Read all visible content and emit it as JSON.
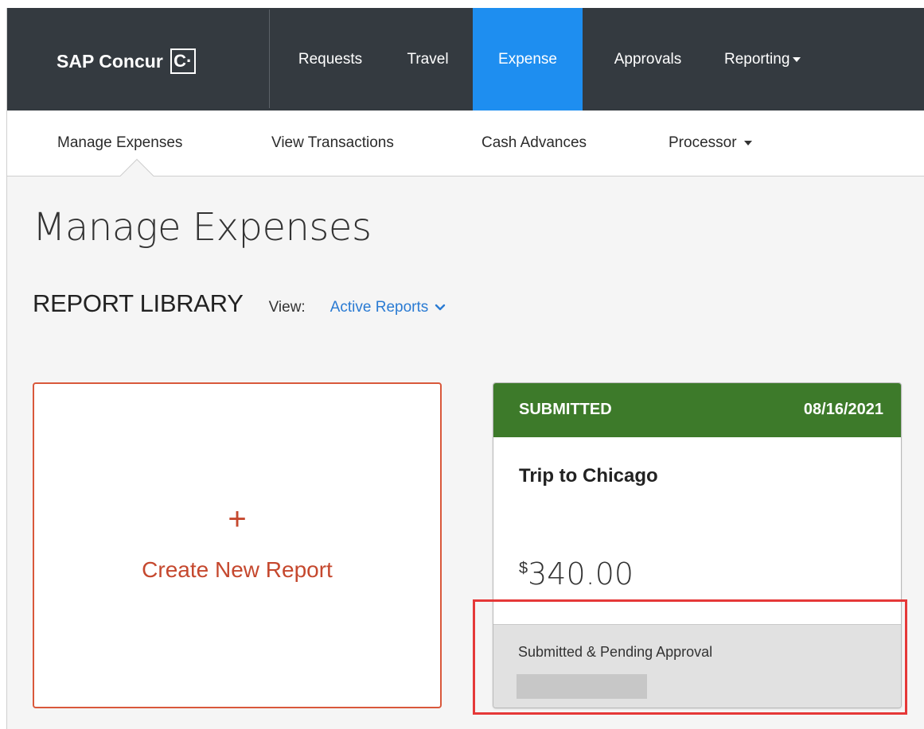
{
  "brand": {
    "name": "SAP Concur",
    "mark": "C·"
  },
  "topnav": {
    "items": [
      {
        "label": "Requests"
      },
      {
        "label": "Travel"
      },
      {
        "label": "Expense"
      },
      {
        "label": "Approvals"
      },
      {
        "label": "Reporting"
      }
    ],
    "active": "Expense"
  },
  "subnav": {
    "items": [
      {
        "label": "Manage Expenses"
      },
      {
        "label": "View Transactions"
      },
      {
        "label": "Cash Advances"
      },
      {
        "label": "Processor"
      }
    ]
  },
  "page": {
    "title": "Manage Expenses",
    "library_title": "REPORT LIBRARY",
    "view_label": "View:",
    "view_value": "Active Reports"
  },
  "create_card": {
    "plus": "+",
    "label": "Create New Report"
  },
  "report_card": {
    "status": "SUBMITTED",
    "date": "08/16/2021",
    "name": "Trip to Chicago",
    "currency": "$",
    "amount": "340.00",
    "footer_status": "Submitted & Pending Approval"
  },
  "colors": {
    "topbar": "#343a40",
    "active_tab": "#1e8ef0",
    "submitted_header": "#3d7a2a",
    "create_accent": "#c5482e",
    "link": "#2a7bd3",
    "highlight": "#e53838"
  }
}
